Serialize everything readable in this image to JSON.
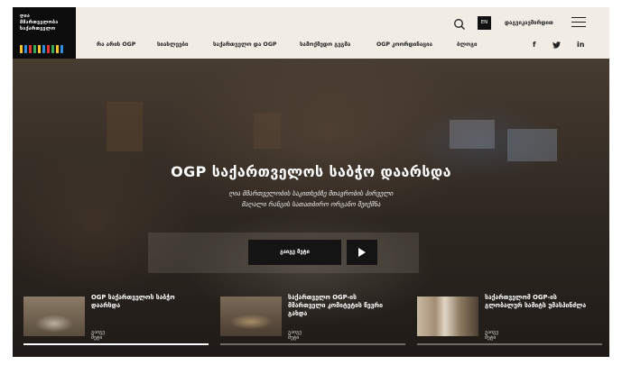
{
  "logo": {
    "lines": "ღია\nმმართველობა\nსაქართველო",
    "stripe_colors": [
      "#f2c230",
      "#2d8fd5",
      "#e3342f",
      "#39a852",
      "#f2c230",
      "#2d8fd5",
      "#e3342f",
      "#39a852",
      "#f2c230",
      "#2d8fd5"
    ]
  },
  "header": {
    "lang_label": "EN",
    "contact_label": "დაგვიკავშირდით",
    "nav": [
      "რა არის OGP",
      "სიახლეები",
      "საქართველო და OGP",
      "სამოქმედო გეგმა",
      "OGP კოორდინაცია",
      "ბლოგი"
    ],
    "social": [
      "f",
      "twitter",
      "in"
    ]
  },
  "hero": {
    "title": "OGP საქართველოს საბჭო დაარსდა",
    "subtitle": "ღია მმართველობის საკითხებზე მთავრობის პირველი\nმაღალი რანგის სათათბირო ორგანო შეიქმნა",
    "cta_label": "გაიგე მეტი"
  },
  "cards": [
    {
      "title": "OGP საქართველოს საბჭო\nდაარსდა",
      "more_label": "გაიგე მეტი",
      "active": true
    },
    {
      "title": "საქართველო OGP-ის\nმმართველი კომიტეტის წევრი\nგახდა",
      "more_label": "გაიგე მეტი",
      "active": false
    },
    {
      "title": "საქართველომ OGP-ის\nგლობალურ სამიტს უმასპინძლა",
      "more_label": "გაიგე მეტი",
      "active": false
    }
  ],
  "colors": {
    "header_bg": "#f1ece4",
    "logo_bg": "#0c0c0c",
    "button_bg": "#141414"
  }
}
